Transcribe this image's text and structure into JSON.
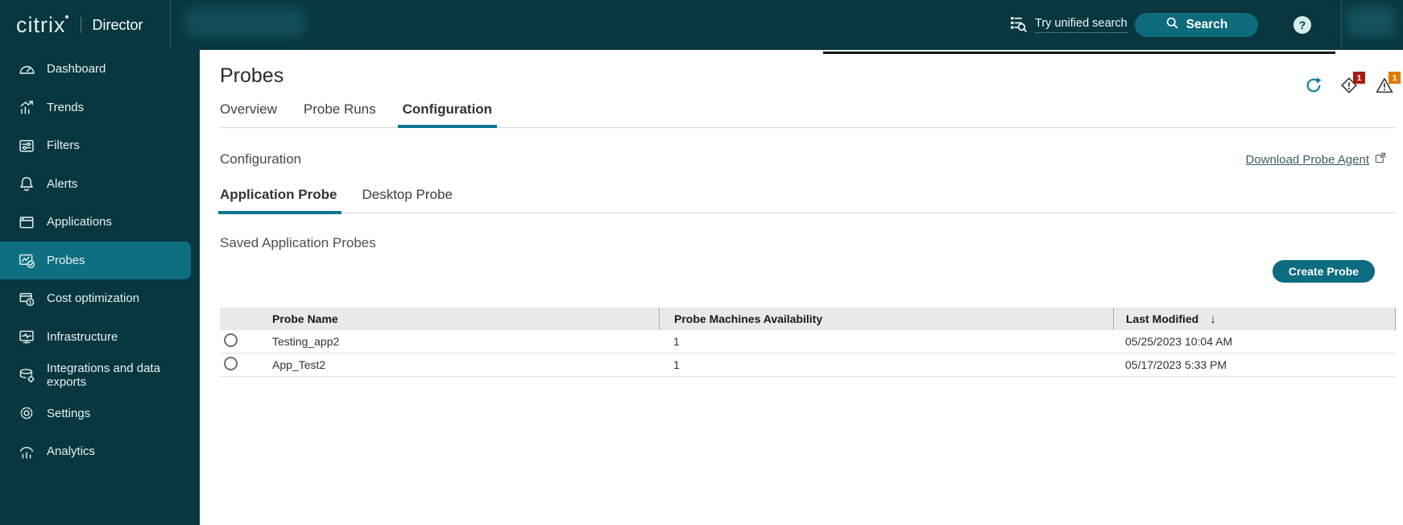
{
  "colors": {
    "topbar_bg": "#083740",
    "sidebar_active_bg": "#0d6f80",
    "accent_teal": "#0e7490",
    "button_teal": "#0c6c80",
    "critical_red": "#a81a10",
    "warning_orange": "#e07c00",
    "link_color": "#3a5c68",
    "table_header_bg": "#e9e9e9"
  },
  "topbar": {
    "logo": "citrix",
    "product": "Director",
    "unified_search": "Try unified search",
    "search": "Search",
    "help": "?"
  },
  "sidebar": {
    "items": [
      {
        "label": "Dashboard",
        "icon": "dashboard-icon",
        "active": false
      },
      {
        "label": "Trends",
        "icon": "trends-icon",
        "active": false
      },
      {
        "label": "Filters",
        "icon": "filters-icon",
        "active": false
      },
      {
        "label": "Alerts",
        "icon": "alerts-icon",
        "active": false
      },
      {
        "label": "Applications",
        "icon": "applications-icon",
        "active": false
      },
      {
        "label": "Probes",
        "icon": "probes-icon",
        "active": true
      },
      {
        "label": "Cost optimization",
        "icon": "cost-optimization-icon",
        "active": false
      },
      {
        "label": "Infrastructure",
        "icon": "infrastructure-icon",
        "active": false
      },
      {
        "label": "Integrations and data exports",
        "icon": "integrations-icon",
        "active": false
      },
      {
        "label": "Settings",
        "icon": "settings-icon",
        "active": false
      },
      {
        "label": "Analytics",
        "icon": "analytics-icon",
        "active": false
      }
    ]
  },
  "header": {
    "title": "Probes",
    "tabs": [
      "Overview",
      "Probe Runs",
      "Configuration"
    ],
    "active_tab": "Configuration",
    "critical_badge": "1",
    "warning_badge": "1"
  },
  "config": {
    "section_title": "Configuration",
    "download_link": "Download Probe Agent",
    "subtabs": [
      "Application Probe",
      "Desktop Probe"
    ],
    "active_subtab": "Application Probe",
    "saved_title": "Saved Application Probes",
    "create_button": "Create Probe"
  },
  "table": {
    "columns": [
      "Probe Name",
      "Probe Machines Availability",
      "Last Modified"
    ],
    "sort_icon": "↓",
    "rows": [
      {
        "name": "Testing_app2",
        "availability": "1",
        "last_modified": "05/25/2023 10:04 AM"
      },
      {
        "name": "App_Test2",
        "availability": "1",
        "last_modified": "05/17/2023 5:33 PM"
      }
    ]
  }
}
